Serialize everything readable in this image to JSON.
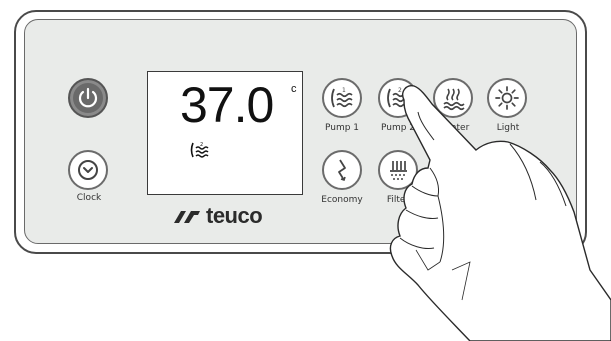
{
  "display": {
    "temperature": "37.0",
    "unit": "c",
    "mode_icon": "pump-wave-icon"
  },
  "buttons": {
    "power": {
      "icon": "power-icon"
    },
    "clock": {
      "label": "Clock",
      "icon": "clock-icon"
    },
    "pump1": {
      "label": "Pump 1",
      "icon": "pump1-wave-icon"
    },
    "pump2": {
      "label": "Pump 2",
      "icon": "pump2-wave-icon"
    },
    "heater": {
      "label": "Heater",
      "icon": "heater-icon"
    },
    "light": {
      "label": "Light",
      "icon": "sun-icon"
    },
    "economy": {
      "label": "Economy",
      "icon": "economy-icon"
    },
    "filter": {
      "label": "Filter",
      "icon": "filter-icon"
    }
  },
  "brand": {
    "name": "teuco"
  },
  "colors": {
    "panel": "#e9ebe9",
    "border": "#4a4a4a",
    "button_ring": "#6b6b6b",
    "power_fill": "#6a6a6a"
  }
}
